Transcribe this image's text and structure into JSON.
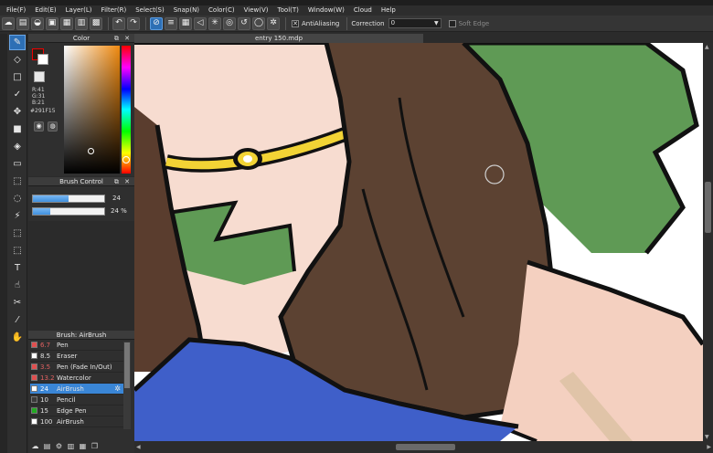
{
  "app": {
    "menu": [
      "File(F)",
      "Edit(E)",
      "Layer(L)",
      "Filter(R)",
      "Select(S)",
      "Snap(N)",
      "Color(C)",
      "View(V)",
      "Tool(T)",
      "Window(W)",
      "Cloud",
      "Help"
    ]
  },
  "toolbar": {
    "antialiasing_label": "AntiAliasing",
    "correction_label": "Correction",
    "correction_value": "0",
    "soft_edge_label": "Soft Edge"
  },
  "color_panel": {
    "title": "Color",
    "r": "R:41",
    "g": "G:31",
    "b": "B:21",
    "hex": "#291F15",
    "current_color": "#291f15"
  },
  "brush_control": {
    "title": "Brush Control",
    "size_value": "24",
    "opacity_value": "24 %",
    "size_fraction": 0.5,
    "opacity_fraction": 0.24
  },
  "document": {
    "tab_title": "entry 150.mdp"
  },
  "brush_panel": {
    "title": "Brush: AirBrush",
    "brushes": [
      {
        "size": "6.7",
        "name": "Pen",
        "color": "#e05050",
        "size_color": "#e06060"
      },
      {
        "size": "8.5",
        "name": "Eraser",
        "color": "#ffffff",
        "size_color": "#e0e0e0"
      },
      {
        "size": "3.5",
        "name": "Pen (Fade In/Out)",
        "color": "#e05050",
        "size_color": "#e06060"
      },
      {
        "size": "13.2",
        "name": "Watercolor",
        "color": "#e05050",
        "size_color": "#e06060"
      },
      {
        "size": "24",
        "name": "AirBrush",
        "color": "#ffffff",
        "size_color": "#ffffff",
        "active": true
      },
      {
        "size": "10",
        "name": "Pencil",
        "color": "#3a3a3a",
        "size_color": "#e0e0e0"
      },
      {
        "size": "15",
        "name": "Edge Pen",
        "color": "#22aa22",
        "size_color": "#e0e0e0"
      },
      {
        "size": "100",
        "name": "AirBrush",
        "color": "#ffffff",
        "size_color": "#e0e0e0"
      }
    ]
  }
}
